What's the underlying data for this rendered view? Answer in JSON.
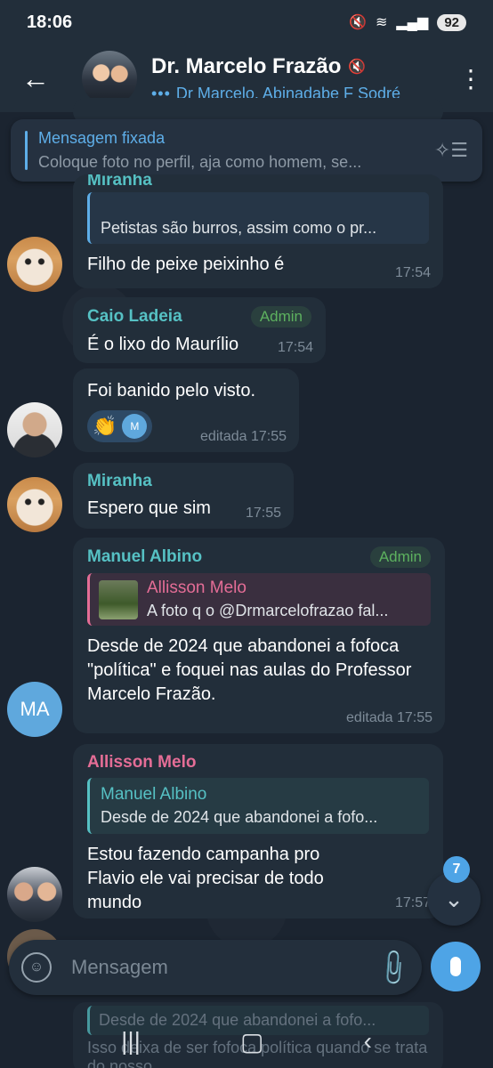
{
  "status_bar": {
    "time": "18:06",
    "battery": "92"
  },
  "header": {
    "title": "Dr. Marcelo Frazão",
    "subtitle": "Dr Marcelo, Abinadabe F Sodré"
  },
  "pinned": {
    "title": "Mensagem fixada",
    "text": "Coloque foto no perfil,  aja como homem,  se..."
  },
  "messages": {
    "m1": {
      "sender": "Miranha",
      "reply_text": "Petistas são burros, assim como o pr...",
      "text": "Filho de peixe peixinho é",
      "time": "17:54"
    },
    "m2": {
      "sender": "Caio Ladeia",
      "badge": "Admin",
      "text": "É o lixo do Maurílio",
      "time": "17:54"
    },
    "m3": {
      "text": "Foi banido pelo visto.",
      "reaction_emoji": "👏",
      "reaction_avatar": "M",
      "time": "editada 17:55"
    },
    "m4": {
      "sender": "Miranha",
      "text": "Espero que sim",
      "time": "17:55"
    },
    "m5": {
      "sender": "Manuel Albino",
      "badge": "Admin",
      "reply_title": "Allisson Melo",
      "reply_text": "A foto q o @Drmarcelofrazao fal...",
      "text": "Desde de 2024 que abandonei a fofoca \"política\" e foquei nas aulas do Professor Marcelo Frazão.",
      "time": "editada 17:55",
      "avatar_initials": "MA"
    },
    "m6": {
      "sender": "Allisson Melo",
      "reply_title": "Manuel Albino",
      "reply_text": "Desde de 2024 que abandonei  a fofo...",
      "text": "Estou fazendo campanha pro Flavio ele vai precisar de todo mundo",
      "time": "17:57"
    },
    "ghost": {
      "reply_text": "Desde de 2024 que abandonei  a fofo...",
      "text": "Isso deixa de ser fofoca política quando se trata do nosso"
    }
  },
  "scroll": {
    "unread_count": "7"
  },
  "input": {
    "placeholder": "Mensagem"
  },
  "colors": {
    "accent": "#4ea4e6",
    "teal_name": "#56c1c4",
    "pink_name": "#e46d96",
    "admin_green": "#5db15f"
  }
}
